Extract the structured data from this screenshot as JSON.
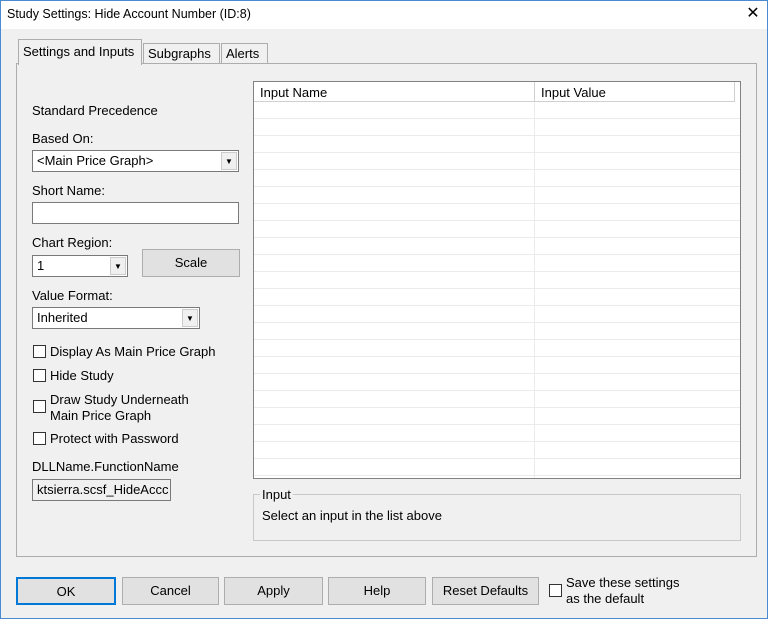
{
  "window": {
    "title": "Study Settings: Hide Account Number (ID:8)",
    "close": "✕"
  },
  "tabs": [
    {
      "label": "Settings and Inputs",
      "active": true
    },
    {
      "label": "Subgraphs"
    },
    {
      "label": "Alerts"
    }
  ],
  "settings": {
    "standard_precedence": "Standard Precedence",
    "based_on_label": "Based On:",
    "based_on_value": "<Main Price Graph>",
    "short_name_label": "Short Name:",
    "short_name_value": "",
    "chart_region_label": "Chart Region:",
    "chart_region_value": "1",
    "scale_button": "Scale",
    "value_format_label": "Value Format:",
    "value_format_value": "Inherited",
    "checkboxes": [
      {
        "label": "Display As Main Price Graph",
        "checked": false
      },
      {
        "label": "Hide Study",
        "checked": false
      },
      {
        "label": "Draw Study Underneath",
        "label2": "Main Price Graph",
        "checked": false
      },
      {
        "label": "Protect with Password",
        "checked": false
      }
    ],
    "dll_label": "DLLName.FunctionName",
    "dll_value": "ktsierra.scsf_HideAccc"
  },
  "inputs_table": {
    "columns": [
      "Input Name",
      "Input Value"
    ],
    "rows": []
  },
  "input_group": {
    "title": "Input",
    "text": "Select an input in the list above"
  },
  "footer": {
    "ok": "OK",
    "cancel": "Cancel",
    "apply": "Apply",
    "help": "Help",
    "reset": "Reset Defaults",
    "save_default": "Save these settings",
    "save_default2": "as the default",
    "save_checked": false
  }
}
